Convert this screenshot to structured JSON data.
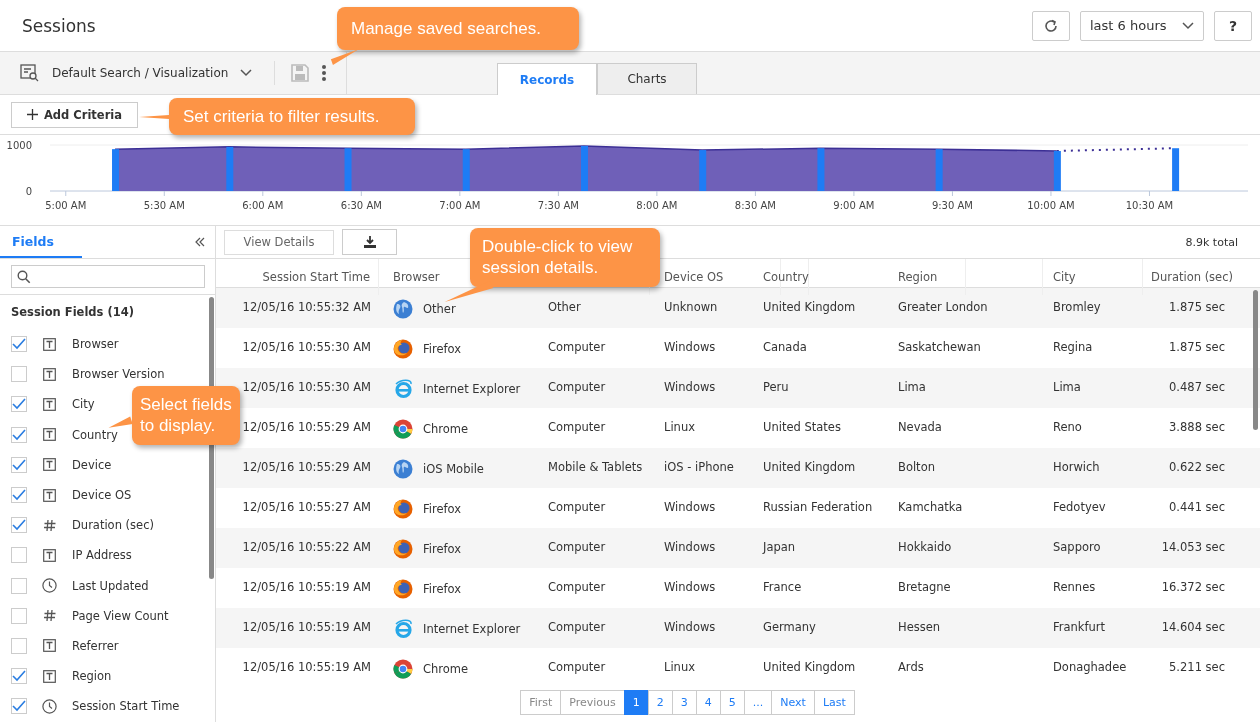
{
  "header": {
    "title": "Sessions",
    "time_range": "last 6 hours",
    "help": "?"
  },
  "toolbar": {
    "search_name": "Default Search / Visualization"
  },
  "tabs": [
    {
      "label": "Records",
      "selected": true
    },
    {
      "label": "Charts",
      "selected": false
    }
  ],
  "add_criteria": "Add Criteria",
  "callouts": [
    {
      "text": "Manage saved searches."
    },
    {
      "text": "Set criteria to filter results."
    },
    {
      "text": "Select fields to display."
    },
    {
      "text": "Double-click to view session details."
    }
  ],
  "timeline": {
    "chart_data": {
      "type": "area",
      "x": [
        5.25,
        5.83,
        6.43,
        7.03,
        7.63,
        8.23,
        8.83,
        9.43,
        10.03,
        10.63
      ],
      "series": [
        {
          "color": "#6f60b8",
          "values": [
            910,
            960,
            930,
            910,
            980,
            890,
            930,
            910,
            870,
            null
          ]
        },
        {
          "color": "#1e7cf5",
          "values": [
            910,
            960,
            930,
            910,
            980,
            890,
            930,
            910,
            870,
            930
          ]
        }
      ],
      "xlim": [
        4.92,
        11
      ],
      "ylim": [
        0,
        1000
      ],
      "yticks": [
        0,
        1000
      ],
      "xticks": [
        {
          "value": 5,
          "label": "5:00 AM"
        },
        {
          "value": 5.5,
          "label": "5:30 AM"
        },
        {
          "value": 6,
          "label": "6:00 AM"
        },
        {
          "value": 6.5,
          "label": "6:30 AM"
        },
        {
          "value": 7,
          "label": "7:00 AM"
        },
        {
          "value": 7.5,
          "label": "7:30 AM"
        },
        {
          "value": 8,
          "label": "8:00 AM"
        },
        {
          "value": 8.5,
          "label": "8:30 AM"
        },
        {
          "value": 9,
          "label": "9:00 AM"
        },
        {
          "value": 9.5,
          "label": "9:30 AM"
        },
        {
          "value": 10,
          "label": "10:00 AM"
        },
        {
          "value": 10.5,
          "label": "10:30 AM"
        }
      ]
    }
  },
  "sidebar": {
    "tab": "Fields",
    "group": "Session Fields (14)",
    "fields": [
      {
        "label": "Browser",
        "kind": "text",
        "checked": true
      },
      {
        "label": "Browser Version",
        "kind": "text",
        "checked": false
      },
      {
        "label": "City",
        "kind": "text",
        "checked": true
      },
      {
        "label": "Country",
        "kind": "text",
        "checked": true
      },
      {
        "label": "Device",
        "kind": "text",
        "checked": true
      },
      {
        "label": "Device OS",
        "kind": "text",
        "checked": true
      },
      {
        "label": "Duration (sec)",
        "kind": "number",
        "checked": true
      },
      {
        "label": "IP Address",
        "kind": "text",
        "checked": false
      },
      {
        "label": "Last Updated",
        "kind": "time",
        "checked": false
      },
      {
        "label": "Page View Count",
        "kind": "number",
        "checked": false
      },
      {
        "label": "Referrer",
        "kind": "text",
        "checked": false
      },
      {
        "label": "Region",
        "kind": "text",
        "checked": true
      },
      {
        "label": "Session Start Time",
        "kind": "time",
        "checked": true
      }
    ]
  },
  "table": {
    "view_details": "View Details",
    "total": "8.9k total",
    "columns": [
      {
        "label": "Session Start Time"
      },
      {
        "label": "Browser"
      },
      {},
      {
        "label": "Device OS"
      },
      {
        "label": "Country"
      },
      {
        "label": "Region"
      },
      {
        "label": "City"
      },
      {
        "label": "Duration (sec)"
      }
    ],
    "rows": [
      {
        "time": "12/05/16 10:55:32 AM",
        "kind": "globe",
        "browser": "Other",
        "device": "Other",
        "os": "Unknown",
        "country": "United Kingdom",
        "region": "Greater London",
        "city": "Bromley",
        "duration": "1.875 sec"
      },
      {
        "time": "12/05/16 10:55:30 AM",
        "kind": "firefox",
        "browser": "Firefox",
        "device": "Computer",
        "os": "Windows",
        "country": "Canada",
        "region": "Saskatchewan",
        "city": "Regina",
        "duration": "1.875 sec"
      },
      {
        "time": "12/05/16 10:55:30 AM",
        "kind": "explorer",
        "browser": "Internet Explorer",
        "device": "Computer",
        "os": "Windows",
        "country": "Peru",
        "region": "Lima",
        "city": "Lima",
        "duration": "0.487 sec"
      },
      {
        "time": "12/05/16 10:55:29 AM",
        "kind": "chrome",
        "browser": "Chrome",
        "device": "Computer",
        "os": "Linux",
        "country": "United States",
        "region": "Nevada",
        "city": "Reno",
        "duration": "3.888 sec"
      },
      {
        "time": "12/05/16 10:55:29 AM",
        "kind": "globe",
        "browser": "iOS Mobile",
        "device": "Mobile & Tablets",
        "os": "iOS - iPhone",
        "country": "United Kingdom",
        "region": "Bolton",
        "city": "Horwich",
        "duration": "0.622 sec"
      },
      {
        "time": "12/05/16 10:55:27 AM",
        "kind": "firefox",
        "browser": "Firefox",
        "device": "Computer",
        "os": "Windows",
        "country": "Russian Federation",
        "region": "Kamchatka",
        "city": "Fedotyev",
        "duration": "0.441 sec"
      },
      {
        "time": "12/05/16 10:55:22 AM",
        "kind": "firefox",
        "browser": "Firefox",
        "device": "Computer",
        "os": "Windows",
        "country": "Japan",
        "region": "Hokkaido",
        "city": "Sapporo",
        "duration": "14.053 sec"
      },
      {
        "time": "12/05/16 10:55:19 AM",
        "kind": "firefox",
        "browser": "Firefox",
        "device": "Computer",
        "os": "Windows",
        "country": "France",
        "region": "Bretagne",
        "city": "Rennes",
        "duration": "16.372 sec"
      },
      {
        "time": "12/05/16 10:55:19 AM",
        "kind": "explorer",
        "browser": "Internet Explorer",
        "device": "Computer",
        "os": "Windows",
        "country": "Germany",
        "region": "Hessen",
        "city": "Frankfurt",
        "duration": "14.604 sec"
      },
      {
        "time": "12/05/16 10:55:19 AM",
        "kind": "chrome",
        "browser": "Chrome",
        "device": "Computer",
        "os": "Linux",
        "country": "United Kingdom",
        "region": "Ards",
        "city": "Donaghadee",
        "duration": "5.211 sec"
      }
    ]
  },
  "pagination": [
    {
      "label": "First",
      "selected": false
    },
    {
      "label": "Previous",
      "selected": false
    },
    {
      "label": "1",
      "selected": true
    },
    {
      "label": "2",
      "selected": false
    },
    {
      "label": "3",
      "selected": false
    },
    {
      "label": "4",
      "selected": false
    },
    {
      "label": "5",
      "selected": false
    },
    {
      "label": "...",
      "selected": false
    },
    {
      "label": "Next",
      "selected": false
    },
    {
      "label": "Last",
      "selected": false
    }
  ]
}
